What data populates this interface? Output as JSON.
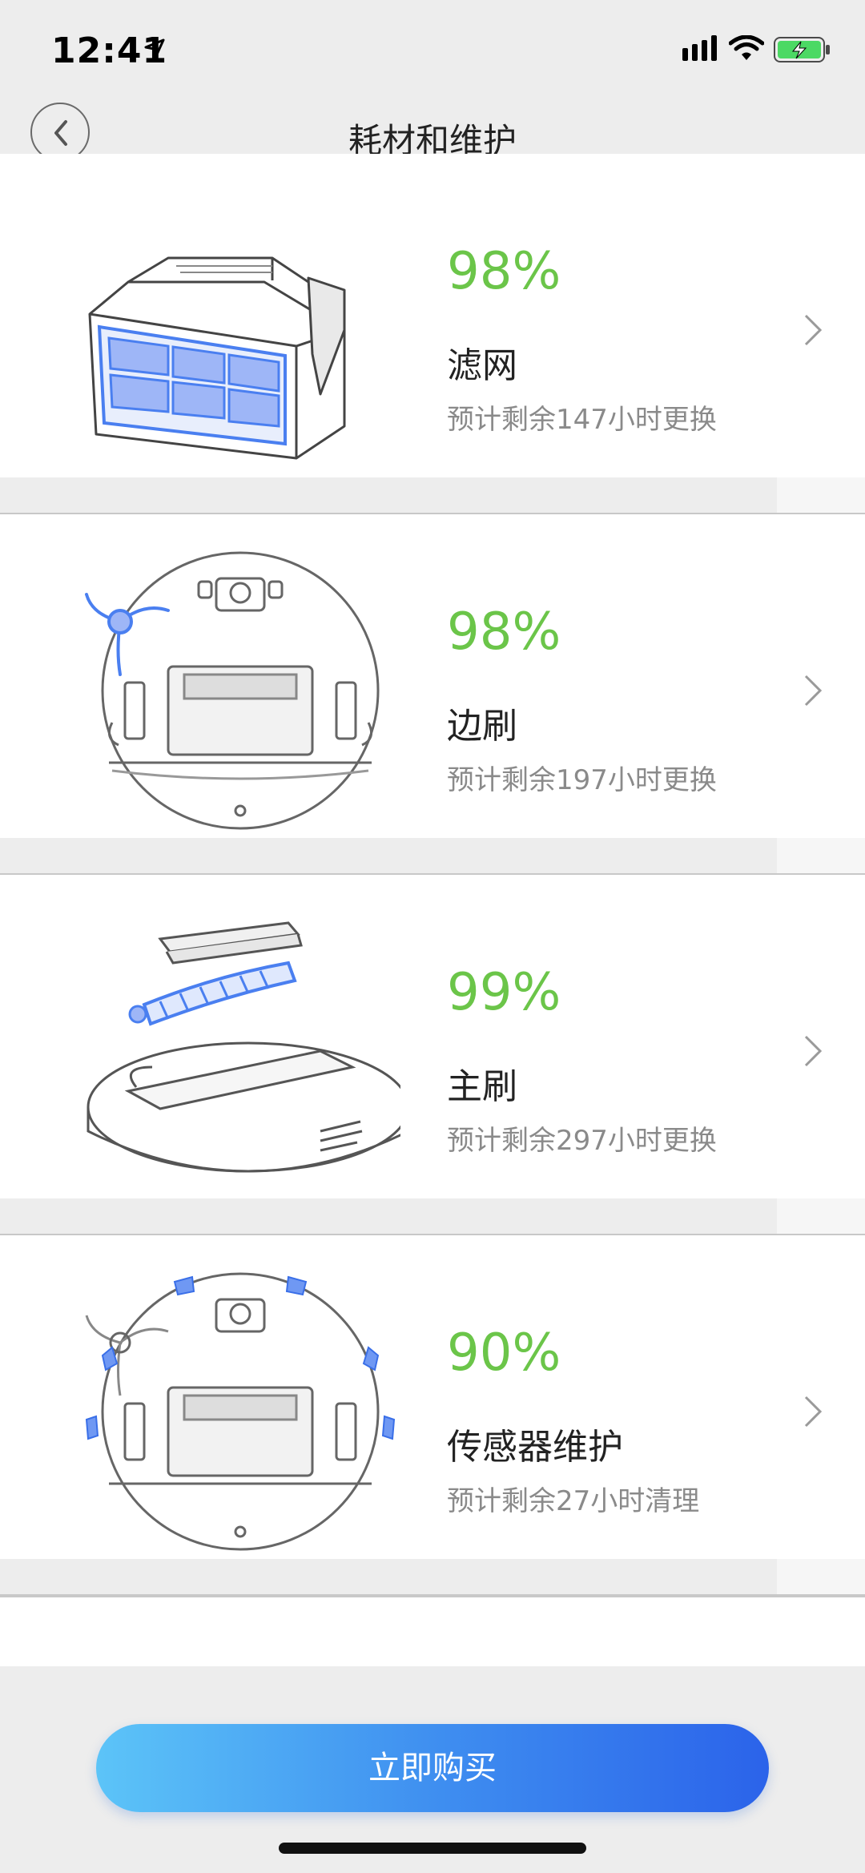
{
  "status": {
    "time": "12:41"
  },
  "nav": {
    "title": "耗材和维护"
  },
  "items": [
    {
      "percent": "98%",
      "name": "滤网",
      "remaining": "预计剩余147小时更换"
    },
    {
      "percent": "98%",
      "name": "边刷",
      "remaining": "预计剩余197小时更换"
    },
    {
      "percent": "99%",
      "name": "主刷",
      "remaining": "预计剩余297小时更换"
    },
    {
      "percent": "90%",
      "name": "传感器维护",
      "remaining": "预计剩余27小时清理"
    }
  ],
  "buy_button": {
    "label": "立即购买"
  },
  "colors": {
    "percent_green": "#6bc549",
    "button_start": "#5cc4f8",
    "button_end": "#2b63ea",
    "accent_blue": "#4a7ff0"
  },
  "icons": [
    "location-arrow-icon",
    "signal-icon",
    "wifi-icon",
    "battery-icon",
    "back-icon",
    "chevron-right-icon"
  ]
}
